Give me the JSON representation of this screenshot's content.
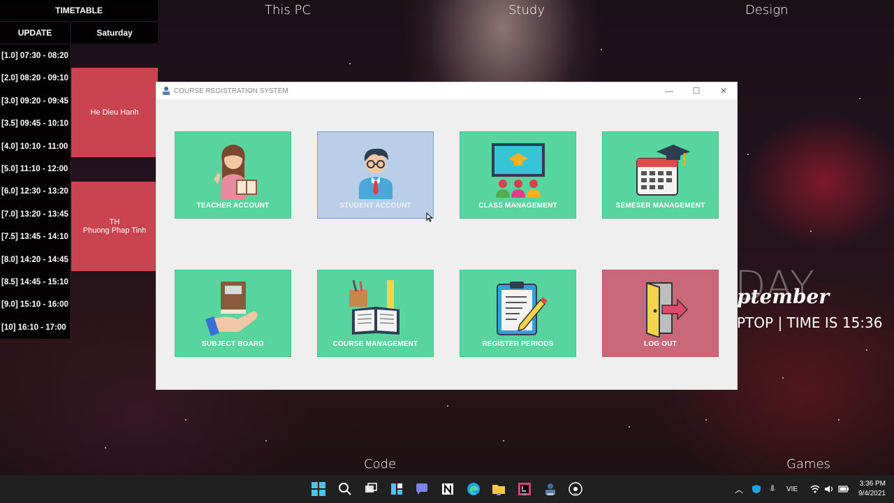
{
  "desktop": {
    "group_labels": {
      "this_pc": "This PC",
      "study": "Study",
      "design": "Design",
      "code": "Code",
      "games": "Games"
    }
  },
  "timetable": {
    "title": "TIMETABLE",
    "update_label": "UPDATE",
    "day_label": "Saturday",
    "times": [
      "[1.0] 07:30 - 08:20",
      "[2.0] 08:20 - 09:10",
      "[3.0] 09:20 - 09:45",
      "[3.5] 09:45 - 10:10",
      "[4.0] 10:10 - 11:00",
      "[5.0] 11:10 - 12:00",
      "[6.0] 12:30 - 13:20",
      "[7.0] 13:20 - 13:45",
      "[7.5] 13:45 - 14:10",
      "[8.0] 14:20 - 14:45",
      "[8.5] 14:45 - 15:10",
      "[9.0] 15:10 - 16:00",
      "[10] 16:10 - 17:00"
    ],
    "events": [
      {
        "line1": "He Dieu Hanh",
        "line2": ""
      },
      {
        "line1": "TH",
        "line2": "Phuong Phap Tinh"
      }
    ]
  },
  "window": {
    "title": "COURSE REGISTRATION SYSTEM",
    "controls": {
      "minimize": "—",
      "maximize": "☐",
      "close": "✕"
    },
    "tiles": [
      {
        "label": "TEACHER ACCOUNT",
        "icon": "teacher-icon"
      },
      {
        "label": "STUDENT ACCOUNT",
        "icon": "student-icon"
      },
      {
        "label": "CLASS MANAGEMENT",
        "icon": "classroom-icon"
      },
      {
        "label": "SEMESER  MANAGEMENT",
        "icon": "calendar-icon"
      },
      {
        "label": "SUBJECT BOARD",
        "icon": "book-hand-icon"
      },
      {
        "label": "COURSE MANAGEMENT",
        "icon": "course-books-icon"
      },
      {
        "label": "REGISTER PERIODS",
        "icon": "clipboard-icon"
      },
      {
        "label": "LOG OUT",
        "icon": "exit-door-icon"
      }
    ],
    "colors": {
      "tile": "#58d59e",
      "tile_hover": "#b9cfe8",
      "logout": "#c96879"
    }
  },
  "clock_widget": {
    "big": "DAY",
    "month": "ptember",
    "line": "PTOP | TIME IS 15:36"
  },
  "taskbar": {
    "language": "VIE",
    "time": "3:36 PM",
    "date": "9/4/2021"
  }
}
